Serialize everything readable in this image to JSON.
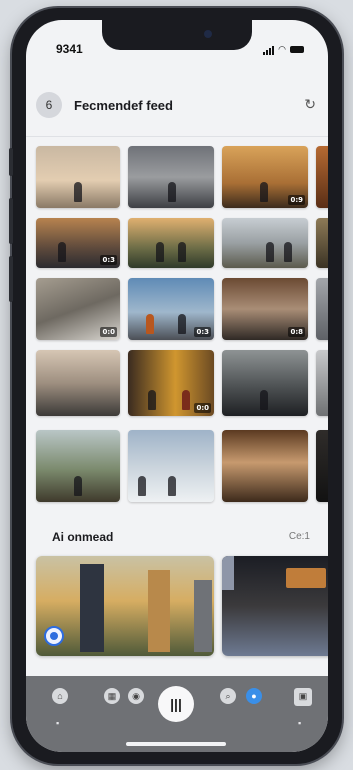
{
  "status_bar": {
    "time": "9341"
  },
  "header": {
    "title": "Fecmendef feed",
    "avatar_glyph": "6",
    "action_icon": "refresh-icon"
  },
  "feed_grid": {
    "durations": [
      "0:9",
      "0:3",
      "0:0",
      "0:3",
      "0:8",
      "0:0"
    ]
  },
  "section": {
    "title": "Ai onmead",
    "action_label": "Ce:1"
  },
  "tabbar": {
    "items": [
      {
        "icon": "home-icon"
      },
      {
        "icon": "grid-icon"
      },
      {
        "icon": "camera-icon"
      },
      {
        "icon": "bars-icon"
      },
      {
        "icon": "search-icon"
      },
      {
        "icon": "dot-icon"
      },
      {
        "icon": "photo-icon"
      }
    ],
    "center_glyph": "|||"
  },
  "colors": {
    "accent": "#2d6cdf",
    "tabbar_bg": "#6f7175"
  }
}
